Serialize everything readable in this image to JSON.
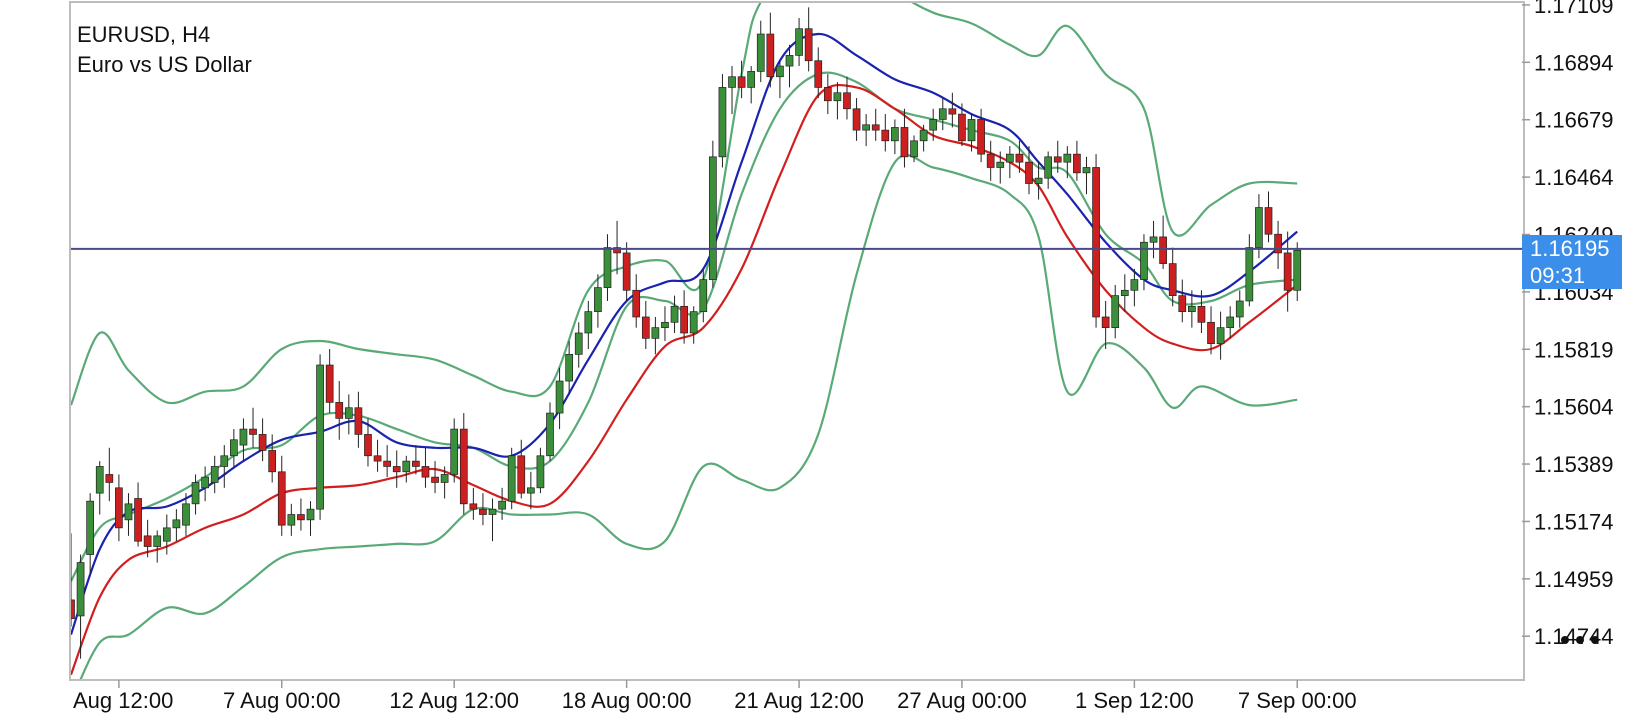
{
  "chart_header": {
    "symbol": "EURUSD, H4",
    "description": "Euro vs US Dollar"
  },
  "current_price": {
    "price": "1.16195",
    "countdown": "09:31",
    "value": 1.16195
  },
  "colors": {
    "bull_candle": "#3b8f3b",
    "bear_candle": "#cc2020",
    "bollinger_bands": "#5aaa78",
    "ma_blue": "#1a22b0",
    "ma_red": "#d21e1e",
    "price_line": "#4a4a8a",
    "price_tag_bg": "#3b8fea",
    "frame": "#bdbdbd"
  },
  "icons": {
    "more": "more-horizontal-icon"
  },
  "chart_data": {
    "type": "candlestick",
    "title": "EURUSD, H4",
    "subtitle": "Euro vs US Dollar",
    "ylim": [
      1.1458,
      1.1712
    ],
    "x_index_range": [
      0,
      128
    ],
    "y_ticks": [
      "1.17109",
      "1.16894",
      "1.16679",
      "1.16464",
      "1.16249",
      "1.16034",
      "1.15819",
      "1.15604",
      "1.15389",
      "1.15174",
      "1.14959",
      "1.14744"
    ],
    "y_tick_values": [
      1.17109,
      1.16894,
      1.16679,
      1.16464,
      1.16249,
      1.16034,
      1.15819,
      1.15604,
      1.15389,
      1.15174,
      1.14959,
      1.14744
    ],
    "x_ticks": [
      {
        "label": "Aug 12:00",
        "index": 5
      },
      {
        "label": "7 Aug 00:00",
        "index": 22
      },
      {
        "label": "12 Aug 12:00",
        "index": 40
      },
      {
        "label": "18 Aug 00:00",
        "index": 58
      },
      {
        "label": "21 Aug 12:00",
        "index": 76
      },
      {
        "label": "27 Aug 00:00",
        "index": 93
      },
      {
        "label": "1 Sep 12:00",
        "index": 111
      },
      {
        "label": "7 Sep 00:00",
        "index": 128
      }
    ],
    "grid": false,
    "current_price_line": 1.16195,
    "candles": [
      [
        1.1488,
        1.1513,
        1.1478,
        1.1481
      ],
      [
        1.1482,
        1.1505,
        1.1466,
        1.1502
      ],
      [
        1.1505,
        1.1528,
        1.1498,
        1.1525
      ],
      [
        1.1528,
        1.154,
        1.152,
        1.1538
      ],
      [
        1.1535,
        1.1545,
        1.1525,
        1.1532
      ],
      [
        1.153,
        1.1535,
        1.151,
        1.1515
      ],
      [
        1.1518,
        1.1528,
        1.1512,
        1.1524
      ],
      [
        1.1526,
        1.1532,
        1.1508,
        1.151
      ],
      [
        1.1512,
        1.1518,
        1.1504,
        1.1508
      ],
      [
        1.1508,
        1.1514,
        1.1502,
        1.1512
      ],
      [
        1.151,
        1.152,
        1.1505,
        1.1515
      ],
      [
        1.1515,
        1.1522,
        1.151,
        1.1518
      ],
      [
        1.1516,
        1.1528,
        1.1512,
        1.1524
      ],
      [
        1.1524,
        1.1535,
        1.152,
        1.1532
      ],
      [
        1.153,
        1.1538,
        1.1525,
        1.1534
      ],
      [
        1.1532,
        1.1542,
        1.1528,
        1.1538
      ],
      [
        1.1538,
        1.1546,
        1.153,
        1.1542
      ],
      [
        1.1542,
        1.1552,
        1.1538,
        1.1548
      ],
      [
        1.1546,
        1.1556,
        1.154,
        1.1552
      ],
      [
        1.1552,
        1.156,
        1.1545,
        1.155
      ],
      [
        1.155,
        1.1556,
        1.154,
        1.1544
      ],
      [
        1.1544,
        1.155,
        1.1532,
        1.1536
      ],
      [
        1.1536,
        1.1542,
        1.1512,
        1.1516
      ],
      [
        1.1516,
        1.1524,
        1.1512,
        1.152
      ],
      [
        1.152,
        1.1526,
        1.1514,
        1.1518
      ],
      [
        1.1518,
        1.1525,
        1.1512,
        1.1522
      ],
      [
        1.1522,
        1.158,
        1.1518,
        1.1576
      ],
      [
        1.1576,
        1.1582,
        1.1558,
        1.1562
      ],
      [
        1.1562,
        1.157,
        1.1548,
        1.1556
      ],
      [
        1.1556,
        1.1565,
        1.155,
        1.156
      ],
      [
        1.156,
        1.1566,
        1.1545,
        1.155
      ],
      [
        1.155,
        1.1556,
        1.1538,
        1.1542
      ],
      [
        1.1542,
        1.1548,
        1.1536,
        1.154
      ],
      [
        1.154,
        1.1546,
        1.1534,
        1.1538
      ],
      [
        1.1538,
        1.1544,
        1.153,
        1.1536
      ],
      [
        1.1536,
        1.1542,
        1.1532,
        1.154
      ],
      [
        1.154,
        1.1546,
        1.1535,
        1.1538
      ],
      [
        1.1538,
        1.1545,
        1.153,
        1.1534
      ],
      [
        1.1534,
        1.154,
        1.1528,
        1.1532
      ],
      [
        1.1532,
        1.1538,
        1.1526,
        1.1535
      ],
      [
        1.1535,
        1.1556,
        1.1532,
        1.1552
      ],
      [
        1.1552,
        1.1558,
        1.152,
        1.1524
      ],
      [
        1.1524,
        1.153,
        1.1518,
        1.1522
      ],
      [
        1.1522,
        1.1528,
        1.1516,
        1.152
      ],
      [
        1.152,
        1.1526,
        1.151,
        1.1522
      ],
      [
        1.1522,
        1.153,
        1.1518,
        1.1525
      ],
      [
        1.1525,
        1.1545,
        1.1522,
        1.1542
      ],
      [
        1.1542,
        1.1548,
        1.1526,
        1.1528
      ],
      [
        1.1528,
        1.1536,
        1.1522,
        1.153
      ],
      [
        1.153,
        1.1545,
        1.1528,
        1.1542
      ],
      [
        1.1542,
        1.1562,
        1.154,
        1.1558
      ],
      [
        1.1558,
        1.1575,
        1.1552,
        1.157
      ],
      [
        1.157,
        1.1585,
        1.1565,
        1.158
      ],
      [
        1.158,
        1.1592,
        1.1575,
        1.1588
      ],
      [
        1.1588,
        1.16,
        1.1582,
        1.1596
      ],
      [
        1.1596,
        1.161,
        1.159,
        1.1605
      ],
      [
        1.1605,
        1.1625,
        1.16,
        1.162
      ],
      [
        1.162,
        1.163,
        1.161,
        1.1618
      ],
      [
        1.1618,
        1.1622,
        1.16,
        1.1604
      ],
      [
        1.1604,
        1.161,
        1.159,
        1.1594
      ],
      [
        1.1594,
        1.16,
        1.1582,
        1.1586
      ],
      [
        1.1586,
        1.1594,
        1.158,
        1.159
      ],
      [
        1.159,
        1.1598,
        1.1585,
        1.1592
      ],
      [
        1.1592,
        1.1602,
        1.1588,
        1.1598
      ],
      [
        1.1598,
        1.1604,
        1.1584,
        1.1588
      ],
      [
        1.1588,
        1.1598,
        1.1584,
        1.1596
      ],
      [
        1.1596,
        1.1612,
        1.1592,
        1.1608
      ],
      [
        1.1608,
        1.166,
        1.1605,
        1.1654
      ],
      [
        1.1654,
        1.1685,
        1.165,
        1.168
      ],
      [
        1.168,
        1.1688,
        1.167,
        1.1684
      ],
      [
        1.1684,
        1.169,
        1.1676,
        1.168
      ],
      [
        1.168,
        1.1688,
        1.1674,
        1.1686
      ],
      [
        1.1686,
        1.1705,
        1.1682,
        1.17
      ],
      [
        1.17,
        1.1708,
        1.168,
        1.1684
      ],
      [
        1.1684,
        1.169,
        1.1676,
        1.1688
      ],
      [
        1.1688,
        1.1696,
        1.168,
        1.1692
      ],
      [
        1.1692,
        1.1706,
        1.1688,
        1.1702
      ],
      [
        1.1702,
        1.171,
        1.1686,
        1.169
      ],
      [
        1.169,
        1.1695,
        1.1676,
        1.168
      ],
      [
        1.168,
        1.1685,
        1.167,
        1.1675
      ],
      [
        1.1675,
        1.1682,
        1.1668,
        1.1678
      ],
      [
        1.1678,
        1.1684,
        1.1668,
        1.1672
      ],
      [
        1.1672,
        1.1676,
        1.166,
        1.1664
      ],
      [
        1.1664,
        1.167,
        1.1658,
        1.1666
      ],
      [
        1.1666,
        1.1672,
        1.166,
        1.1664
      ],
      [
        1.1664,
        1.167,
        1.1656,
        1.166
      ],
      [
        1.166,
        1.1668,
        1.1655,
        1.1665
      ],
      [
        1.1665,
        1.1672,
        1.165,
        1.1654
      ],
      [
        1.1654,
        1.1662,
        1.1652,
        1.166
      ],
      [
        1.166,
        1.1666,
        1.1656,
        1.1664
      ],
      [
        1.1664,
        1.1672,
        1.166,
        1.1668
      ],
      [
        1.1668,
        1.1676,
        1.1664,
        1.1672
      ],
      [
        1.1672,
        1.1678,
        1.1665,
        1.167
      ],
      [
        1.167,
        1.1674,
        1.1658,
        1.166
      ],
      [
        1.166,
        1.167,
        1.1656,
        1.1668
      ],
      [
        1.1668,
        1.1672,
        1.1652,
        1.1655
      ],
      [
        1.1655,
        1.166,
        1.1645,
        1.165
      ],
      [
        1.165,
        1.1656,
        1.1644,
        1.1652
      ],
      [
        1.1652,
        1.1658,
        1.1646,
        1.1655
      ],
      [
        1.1655,
        1.166,
        1.1648,
        1.1652
      ],
      [
        1.1652,
        1.1658,
        1.164,
        1.1644
      ],
      [
        1.1644,
        1.1652,
        1.1638,
        1.1646
      ],
      [
        1.1646,
        1.1656,
        1.1642,
        1.1654
      ],
      [
        1.1654,
        1.166,
        1.1648,
        1.1652
      ],
      [
        1.1652,
        1.1658,
        1.1646,
        1.1655
      ],
      [
        1.1655,
        1.166,
        1.1645,
        1.1648
      ],
      [
        1.1648,
        1.1654,
        1.164,
        1.165
      ],
      [
        1.165,
        1.1655,
        1.159,
        1.1594
      ],
      [
        1.1594,
        1.16,
        1.1582,
        1.159
      ],
      [
        1.159,
        1.1606,
        1.1586,
        1.1602
      ],
      [
        1.1602,
        1.161,
        1.1596,
        1.1604
      ],
      [
        1.1604,
        1.1612,
        1.1598,
        1.1608
      ],
      [
        1.1608,
        1.1625,
        1.1604,
        1.1622
      ],
      [
        1.1622,
        1.163,
        1.1616,
        1.1624
      ],
      [
        1.1624,
        1.1632,
        1.1612,
        1.1614
      ],
      [
        1.1614,
        1.162,
        1.1598,
        1.1602
      ],
      [
        1.1602,
        1.1608,
        1.1592,
        1.1596
      ],
      [
        1.1596,
        1.1604,
        1.159,
        1.1598
      ],
      [
        1.1598,
        1.1604,
        1.1588,
        1.1592
      ],
      [
        1.1592,
        1.1598,
        1.158,
        1.1584
      ],
      [
        1.1584,
        1.1596,
        1.1578,
        1.159
      ],
      [
        1.159,
        1.1598,
        1.1586,
        1.1594
      ],
      [
        1.1594,
        1.1604,
        1.159,
        1.16
      ],
      [
        1.16,
        1.1625,
        1.1598,
        1.162
      ],
      [
        1.162,
        1.164,
        1.1616,
        1.1635
      ],
      [
        1.1635,
        1.1641,
        1.1622,
        1.1625
      ],
      [
        1.1625,
        1.163,
        1.1612,
        1.1618
      ],
      [
        1.1618,
        1.1626,
        1.1596,
        1.1604
      ],
      [
        1.1604,
        1.1622,
        1.16,
        1.1619
      ]
    ],
    "bb_upper": [
      [
        0,
        1.1561
      ],
      [
        3,
        1.1588
      ],
      [
        6,
        1.1574
      ],
      [
        10,
        1.1562
      ],
      [
        14,
        1.1566
      ],
      [
        18,
        1.1568
      ],
      [
        22,
        1.1582
      ],
      [
        26,
        1.1585
      ],
      [
        30,
        1.1582
      ],
      [
        34,
        1.158
      ],
      [
        38,
        1.1578
      ],
      [
        42,
        1.1572
      ],
      [
        46,
        1.1566
      ],
      [
        50,
        1.1568
      ],
      [
        54,
        1.1604
      ],
      [
        58,
        1.1613
      ],
      [
        62,
        1.1615
      ],
      [
        66,
        1.1608
      ],
      [
        70,
        1.1685
      ],
      [
        72,
        1.1712
      ],
      [
        77,
        1.173
      ],
      [
        82,
        1.1728
      ],
      [
        86,
        1.1716
      ],
      [
        90,
        1.1708
      ],
      [
        94,
        1.1704
      ],
      [
        98,
        1.1696
      ],
      [
        101,
        1.1692
      ],
      [
        104,
        1.1703
      ],
      [
        108,
        1.1685
      ],
      [
        112,
        1.1672
      ],
      [
        115,
        1.1626
      ],
      [
        119,
        1.1636
      ],
      [
        123,
        1.1644
      ],
      [
        128,
        1.1644
      ]
    ],
    "bb_middle": [
      [
        0,
        1.1495
      ],
      [
        3,
        1.1515
      ],
      [
        6,
        1.152
      ],
      [
        10,
        1.1526
      ],
      [
        14,
        1.1534
      ],
      [
        18,
        1.1544
      ],
      [
        22,
        1.1546
      ],
      [
        26,
        1.1557
      ],
      [
        30,
        1.1557
      ],
      [
        34,
        1.1552
      ],
      [
        38,
        1.1547
      ],
      [
        42,
        1.1545
      ],
      [
        46,
        1.1538
      ],
      [
        50,
        1.154
      ],
      [
        54,
        1.1562
      ],
      [
        58,
        1.1598
      ],
      [
        62,
        1.16
      ],
      [
        66,
        1.1597
      ],
      [
        70,
        1.164
      ],
      [
        74,
        1.1672
      ],
      [
        78,
        1.1685
      ],
      [
        82,
        1.1682
      ],
      [
        86,
        1.1672
      ],
      [
        90,
        1.1668
      ],
      [
        94,
        1.1664
      ],
      [
        98,
        1.166
      ],
      [
        101,
        1.165
      ],
      [
        104,
        1.1648
      ],
      [
        108,
        1.1625
      ],
      [
        112,
        1.1614
      ],
      [
        115,
        1.16
      ],
      [
        119,
        1.16
      ],
      [
        123,
        1.1606
      ],
      [
        128,
        1.1608
      ]
    ],
    "bb_lower": [
      [
        0,
        1.145
      ],
      [
        3,
        1.1472
      ],
      [
        6,
        1.1475
      ],
      [
        10,
        1.1485
      ],
      [
        14,
        1.1483
      ],
      [
        18,
        1.1493
      ],
      [
        22,
        1.1504
      ],
      [
        26,
        1.1507
      ],
      [
        30,
        1.1508
      ],
      [
        34,
        1.1509
      ],
      [
        38,
        1.151
      ],
      [
        42,
        1.1522
      ],
      [
        46,
        1.152
      ],
      [
        50,
        1.152
      ],
      [
        54,
        1.152
      ],
      [
        58,
        1.1509
      ],
      [
        62,
        1.151
      ],
      [
        66,
        1.1538
      ],
      [
        70,
        1.1533
      ],
      [
        74,
        1.153
      ],
      [
        78,
        1.155
      ],
      [
        82,
        1.161
      ],
      [
        86,
        1.1652
      ],
      [
        90,
        1.165
      ],
      [
        94,
        1.1646
      ],
      [
        98,
        1.164
      ],
      [
        101,
        1.1624
      ],
      [
        104,
        1.1566
      ],
      [
        108,
        1.1584
      ],
      [
        112,
        1.1575
      ],
      [
        115,
        1.156
      ],
      [
        118,
        1.1568
      ],
      [
        123,
        1.1561
      ],
      [
        128,
        1.1563
      ]
    ],
    "ma_blue": [
      [
        0,
        1.1475
      ],
      [
        3,
        1.1507
      ],
      [
        6,
        1.1521
      ],
      [
        10,
        1.1523
      ],
      [
        14,
        1.153
      ],
      [
        18,
        1.154
      ],
      [
        22,
        1.1548
      ],
      [
        26,
        1.1551
      ],
      [
        30,
        1.1555
      ],
      [
        34,
        1.1547
      ],
      [
        38,
        1.1545
      ],
      [
        42,
        1.1545
      ],
      [
        46,
        1.1542
      ],
      [
        50,
        1.1554
      ],
      [
        54,
        1.1578
      ],
      [
        58,
        1.16
      ],
      [
        62,
        1.1607
      ],
      [
        66,
        1.1612
      ],
      [
        70,
        1.1652
      ],
      [
        74,
        1.169
      ],
      [
        78,
        1.17
      ],
      [
        82,
        1.1692
      ],
      [
        86,
        1.1683
      ],
      [
        90,
        1.1678
      ],
      [
        94,
        1.167
      ],
      [
        98,
        1.1664
      ],
      [
        101,
        1.1652
      ],
      [
        104,
        1.164
      ],
      [
        108,
        1.1622
      ],
      [
        112,
        1.1608
      ],
      [
        115,
        1.1604
      ],
      [
        119,
        1.1602
      ],
      [
        123,
        1.1611
      ],
      [
        128,
        1.1626
      ]
    ],
    "ma_red": [
      [
        0,
        1.146
      ],
      [
        3,
        1.1489
      ],
      [
        6,
        1.1503
      ],
      [
        10,
        1.1508
      ],
      [
        14,
        1.1515
      ],
      [
        18,
        1.152
      ],
      [
        22,
        1.1528
      ],
      [
        26,
        1.153
      ],
      [
        30,
        1.1531
      ],
      [
        34,
        1.1534
      ],
      [
        38,
        1.1537
      ],
      [
        42,
        1.1531
      ],
      [
        46,
        1.1525
      ],
      [
        50,
        1.1524
      ],
      [
        54,
        1.154
      ],
      [
        58,
        1.1563
      ],
      [
        62,
        1.1583
      ],
      [
        66,
        1.159
      ],
      [
        70,
        1.1612
      ],
      [
        74,
        1.1647
      ],
      [
        78,
        1.1677
      ],
      [
        82,
        1.168
      ],
      [
        86,
        1.1672
      ],
      [
        90,
        1.1662
      ],
      [
        94,
        1.1658
      ],
      [
        98,
        1.1652
      ],
      [
        101,
        1.1643
      ],
      [
        104,
        1.1624
      ],
      [
        108,
        1.1604
      ],
      [
        112,
        1.159
      ],
      [
        115,
        1.1584
      ],
      [
        119,
        1.1582
      ],
      [
        123,
        1.1592
      ],
      [
        128,
        1.1606
      ]
    ]
  }
}
